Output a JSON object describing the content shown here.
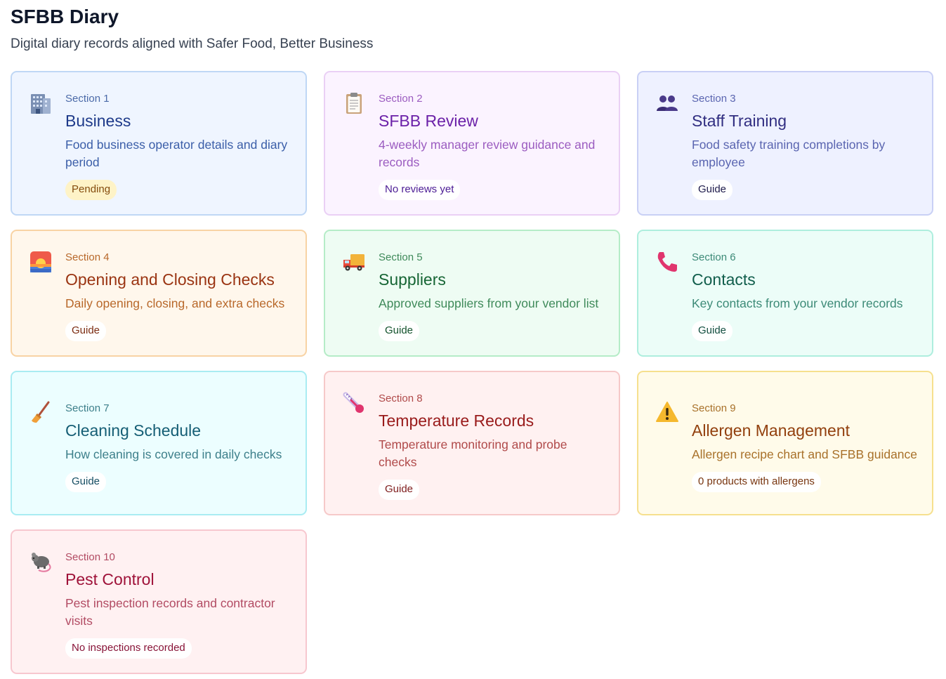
{
  "header": {
    "title": "SFBB Diary",
    "subtitle": "Digital diary records aligned with Safer Food, Better Business"
  },
  "cards": [
    {
      "section": "Section 1",
      "title": "Business",
      "description": "Food business operator details and diary period",
      "badge": "Pending",
      "icon": "office-building-icon",
      "theme": "#eff5ff"
    },
    {
      "section": "Section 2",
      "title": "SFBB Review",
      "description": "4-weekly manager review guidance and records",
      "badge": "No reviews yet",
      "icon": "clipboard-icon",
      "theme": "#fbf3ff"
    },
    {
      "section": "Section 3",
      "title": "Staff Training",
      "description": "Food safety training completions by employee",
      "badge": "Guide",
      "icon": "people-icon",
      "theme": "#eef1ff"
    },
    {
      "section": "Section 4",
      "title": "Opening and Closing Checks",
      "description": "Daily opening, closing, and extra checks",
      "badge": "Guide",
      "icon": "sunrise-icon",
      "theme": "#fff7ec"
    },
    {
      "section": "Section 5",
      "title": "Suppliers",
      "description": "Approved suppliers from your vendor list",
      "badge": "Guide",
      "icon": "delivery-truck-icon",
      "theme": "#eefcf3"
    },
    {
      "section": "Section 6",
      "title": "Contacts",
      "description": "Key contacts from your vendor records",
      "badge": "Guide",
      "icon": "telephone-receiver-icon",
      "theme": "#ecfdf8"
    },
    {
      "section": "Section 7",
      "title": "Cleaning Schedule",
      "description": "How cleaning is covered in daily checks",
      "badge": "Guide",
      "icon": "broom-icon",
      "theme": "#ecfeff"
    },
    {
      "section": "Section 8",
      "title": "Temperature Records",
      "description": "Temperature monitoring and probe checks",
      "badge": "Guide",
      "icon": "thermometer-icon",
      "theme": "#fff1f1"
    },
    {
      "section": "Section 9",
      "title": "Allergen Management",
      "description": "Allergen recipe chart and SFBB guidance",
      "badge": "0 products with allergens",
      "icon": "warning-icon",
      "theme": "#fffbea"
    },
    {
      "section": "Section 10",
      "title": "Pest Control",
      "description": "Pest inspection records and contractor visits",
      "badge": "No inspections recorded",
      "icon": "rat-icon",
      "theme": "#fff1f2"
    }
  ]
}
